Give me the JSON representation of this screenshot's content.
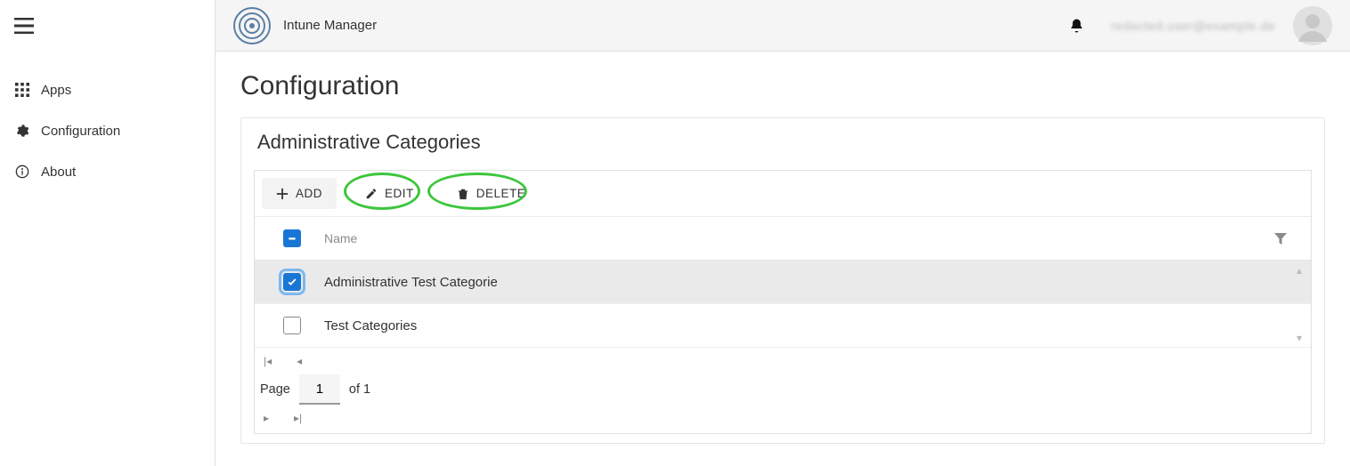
{
  "header": {
    "app_title": "Intune Manager",
    "user_text": "redacted.user@example.de"
  },
  "sidebar": {
    "items": [
      {
        "label": "Apps"
      },
      {
        "label": "Configuration"
      },
      {
        "label": "About"
      }
    ]
  },
  "page": {
    "title": "Configuration",
    "panel_title": "Administrative Categories"
  },
  "toolbar": {
    "add_label": "ADD",
    "edit_label": "EDIT",
    "delete_label": "DELETE"
  },
  "grid": {
    "header_name": "Name",
    "rows": [
      {
        "label": "Administrative Test Categorie",
        "checked": true
      },
      {
        "label": "Test Categories",
        "checked": false
      }
    ]
  },
  "pager": {
    "page_label": "Page",
    "current": "1",
    "of_label": "of 1"
  }
}
